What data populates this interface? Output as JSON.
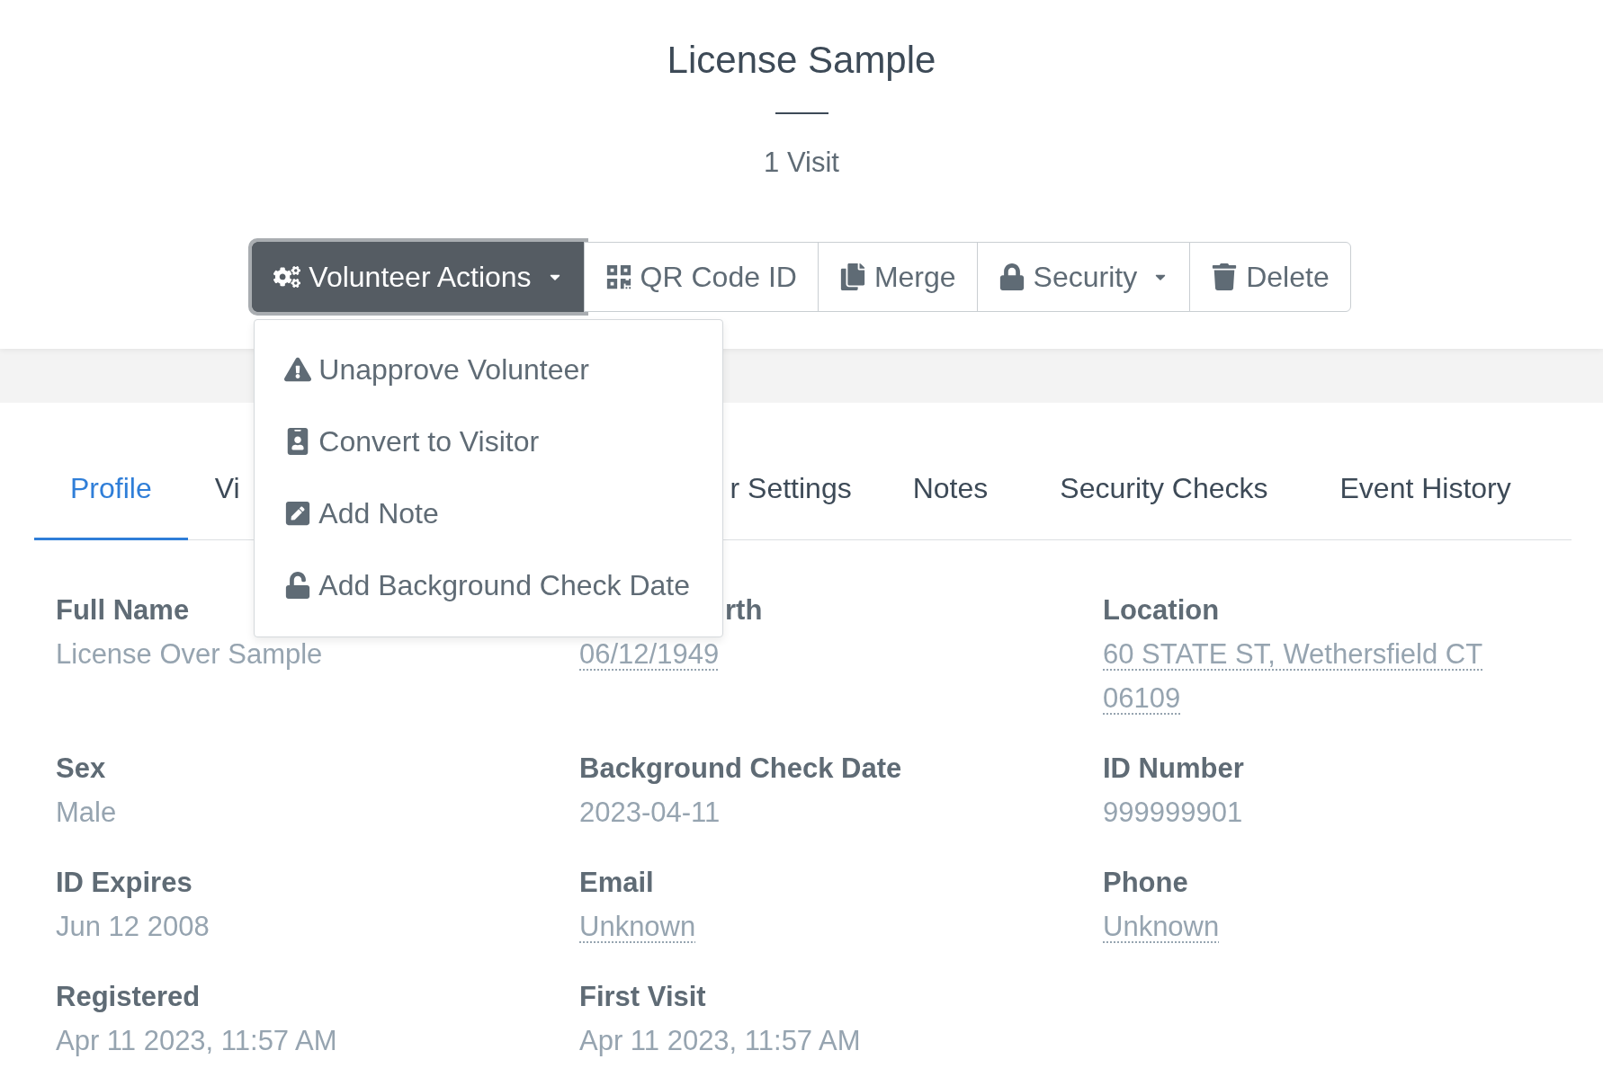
{
  "header": {
    "title": "License Sample",
    "subtitle": "1 Visit"
  },
  "toolbar": [
    {
      "label": "Volunteer Actions",
      "kind": "dropdown",
      "expanded": true
    },
    {
      "label": "QR Code ID",
      "kind": "button"
    },
    {
      "label": "Merge",
      "kind": "button"
    },
    {
      "label": "Security",
      "kind": "dropdown",
      "expanded": false
    },
    {
      "label": "Delete",
      "kind": "button"
    }
  ],
  "dropdown_menu": [
    "Unapprove Volunteer",
    "Convert to Visitor",
    "Add Note",
    "Add Background Check Date"
  ],
  "tabs": [
    {
      "label": "Profile",
      "selected": true,
      "kind": "full"
    },
    {
      "label": "Vi",
      "selected": false,
      "kind": "cut_right"
    },
    {
      "label": "r Settings",
      "selected": false,
      "kind": "cut_left"
    },
    {
      "label": "Notes",
      "selected": false,
      "kind": "full"
    },
    {
      "label": "Security Checks",
      "selected": false,
      "kind": "full"
    },
    {
      "label": "Event History",
      "selected": false,
      "kind": "full"
    }
  ],
  "fields": [
    {
      "label": "Full Name",
      "value": "License Over Sample",
      "kind": "text"
    },
    {
      "label": "rth",
      "value": "06/12/1949",
      "kind": "link",
      "label_cut": true
    },
    {
      "label": "Location",
      "value": "60 STATE ST, Wethersfield CT 06109",
      "kind": "link"
    },
    {
      "label": "Sex",
      "value": "Male",
      "kind": "text"
    },
    {
      "label": "Background Check Date",
      "value": "2023-04-11",
      "kind": "text"
    },
    {
      "label": "ID Number",
      "value": "999999901",
      "kind": "text"
    },
    {
      "label": "ID Expires",
      "value": "Jun 12 2008",
      "kind": "text"
    },
    {
      "label": "Email",
      "value": "Unknown",
      "kind": "link"
    },
    {
      "label": "Phone",
      "value": "Unknown",
      "kind": "link"
    },
    {
      "label": "Registered",
      "value": "Apr 11 2023, 11:57 AM",
      "kind": "text"
    },
    {
      "label": "First Visit",
      "value": "Apr 11 2023, 11:57 AM",
      "kind": "text"
    }
  ]
}
